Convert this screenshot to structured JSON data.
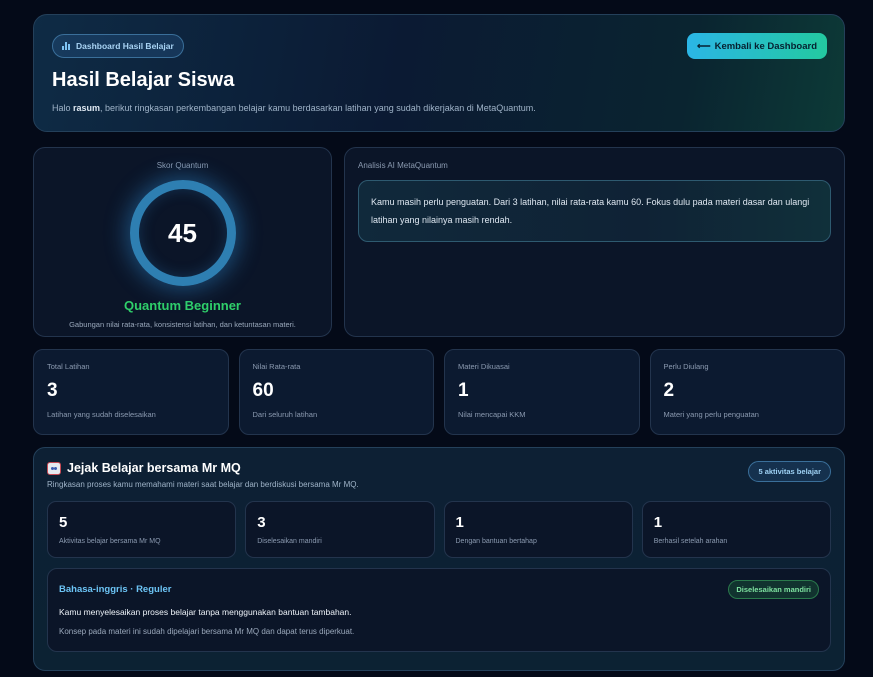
{
  "header": {
    "badge_label": "Dashboard Hasil Belajar",
    "badge_icon": "bar-chart-icon",
    "title": "Hasil Belajar Siswa",
    "subtitle_prefix": "Halo ",
    "student_name": "rasum",
    "subtitle_suffix": ", berikut ringkasan perkembangan belajar kamu berdasarkan latihan yang sudah dikerjakan di MetaQuantum.",
    "back_button_icon": "arrow-left-icon",
    "back_button_label": "Kembali ke Dashboard"
  },
  "score": {
    "caption": "Skor Quantum",
    "value": "45",
    "level": "Quantum Beginner",
    "description": "Gabungan nilai rata-rata, konsistensi latihan, dan ketuntasan materi."
  },
  "analysis": {
    "caption": "Analisis AI MetaQuantum",
    "text": "Kamu masih perlu penguatan. Dari 3 latihan, nilai rata-rata kamu 60. Fokus dulu pada materi dasar dan ulangi latihan yang nilainya masih rendah."
  },
  "stats": [
    {
      "label": "Total Latihan",
      "value": "3",
      "note": "Latihan yang sudah diselesaikan"
    },
    {
      "label": "Nilai Rata-rata",
      "value": "60",
      "note": "Dari seluruh latihan"
    },
    {
      "label": "Materi Dikuasai",
      "value": "1",
      "note": "Nilai mencapai KKM"
    },
    {
      "label": "Perlu Diulang",
      "value": "2",
      "note": "Materi yang perlu penguatan"
    }
  ],
  "journey": {
    "icon": "robot-icon",
    "title": "Jejak Belajar bersama Mr MQ",
    "subtitle": "Ringkasan proses kamu memahami materi saat belajar dan berdiskusi bersama Mr MQ.",
    "badge": "5 aktivitas belajar",
    "mini_stats": [
      {
        "value": "5",
        "label": "Aktivitas belajar bersama Mr MQ"
      },
      {
        "value": "3",
        "label": "Diselesaikan mandiri"
      },
      {
        "value": "1",
        "label": "Dengan bantuan bertahap"
      },
      {
        "value": "1",
        "label": "Berhasil setelah arahan"
      }
    ],
    "activity": {
      "title": "Bahasa-inggris · Reguler",
      "status": "Diselesaikan mandiri",
      "line1": "Kamu menyelesaikan proses belajar tanpa menggunakan bantuan tambahan.",
      "line2": "Konsep pada materi ini sudah dipelajari bersama Mr MQ dan dapat terus diperkuat."
    }
  },
  "colors": {
    "background": "#040a18",
    "accent_blue": "#2e7fb2",
    "level_green": "#2fd06a",
    "button_gradient_start": "#2bb6e6",
    "button_gradient_end": "#23c9a0",
    "activity_title": "#6cc4f5"
  }
}
